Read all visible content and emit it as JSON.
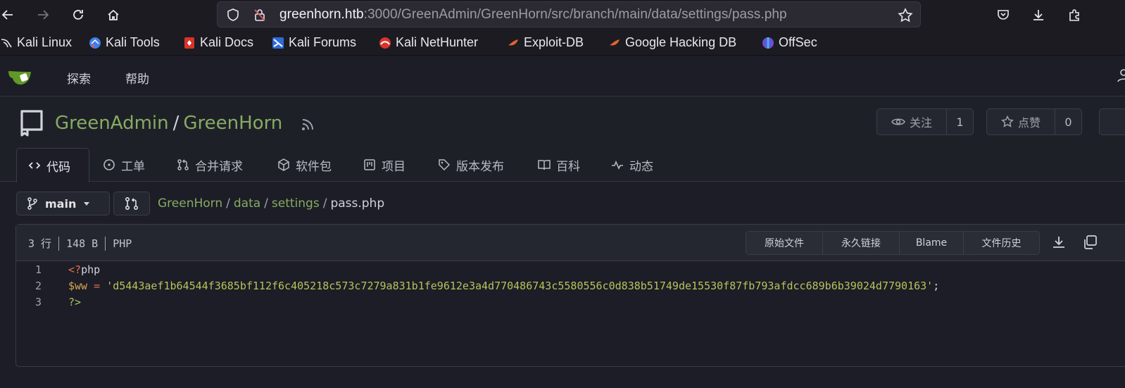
{
  "browser": {
    "url_host": "greenhorn.htb",
    "url_rest": ":3000/GreenAdmin/GreenHorn/src/branch/main/data/settings/pass.php",
    "bookmarks": [
      {
        "label": "Kali Linux",
        "icon": "kali-dragon-icon"
      },
      {
        "label": "Kali Tools",
        "icon": "kali-tools-icon"
      },
      {
        "label": "Kali Docs",
        "icon": "kali-docs-icon"
      },
      {
        "label": "Kali Forums",
        "icon": "kali-forums-icon"
      },
      {
        "label": "Kali NetHunter",
        "icon": "nethunter-icon"
      },
      {
        "label": "Exploit-DB",
        "icon": "exploit-db-icon"
      },
      {
        "label": "Google Hacking DB",
        "icon": "ghdb-icon"
      },
      {
        "label": "OffSec",
        "icon": "offsec-icon"
      }
    ]
  },
  "topnav": {
    "explore": "探索",
    "help": "帮助"
  },
  "repo": {
    "owner": "GreenAdmin",
    "separator": "/",
    "name": "GreenHorn",
    "watch_label": "关注",
    "watch_count": "1",
    "star_label": "点赞",
    "star_count": "0"
  },
  "tabs": [
    {
      "label": "代码",
      "icon": "code-icon",
      "active": true
    },
    {
      "label": "工单",
      "icon": "issue-icon"
    },
    {
      "label": "合并请求",
      "icon": "pull-request-icon"
    },
    {
      "label": "软件包",
      "icon": "package-icon"
    },
    {
      "label": "项目",
      "icon": "project-icon"
    },
    {
      "label": "版本发布",
      "icon": "tag-icon"
    },
    {
      "label": "百科",
      "icon": "book-icon"
    },
    {
      "label": "动态",
      "icon": "pulse-icon"
    }
  ],
  "branch": {
    "name": "main"
  },
  "breadcrumb": {
    "root": "GreenHorn",
    "dir1": "data",
    "dir2": "settings",
    "file": "pass.php",
    "sep": "/"
  },
  "file": {
    "lines_info": "3 行",
    "size": "148 B",
    "lang": "PHP",
    "buttons": {
      "raw": "原始文件",
      "permalink": "永久链接",
      "blame": "Blame",
      "history": "文件历史"
    }
  },
  "code": {
    "line1_num": "1",
    "line1_tag": "<?",
    "line1_kw": "php",
    "line2_num": "2",
    "line2_var": "$ww",
    "line2_op": " = ",
    "line2_str": "'d5443aef1b64544f3685bf112f6c405218c573c7279a831b1fe9612e3a4d770486743c5580556c0d838b51749de15530f87fb793afdcc689b6b39024d7790163'",
    "line2_end": ";",
    "line3_num": "3",
    "line3_tag": "?>"
  },
  "colors": {
    "accent_link": "#87ab63",
    "background": "#1c1d26"
  }
}
